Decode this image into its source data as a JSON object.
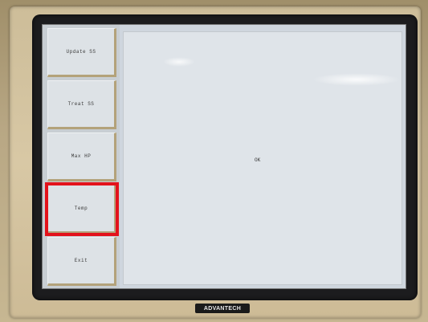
{
  "menu": {
    "items": [
      {
        "label": "Update SS"
      },
      {
        "label": "Treat SS"
      },
      {
        "label": "Max HP"
      },
      {
        "label": "Temp"
      },
      {
        "label": "Exit"
      }
    ],
    "selected_index": 3
  },
  "main": {
    "text": "OK"
  },
  "device": {
    "brand": "ADVANTECH"
  },
  "colors": {
    "selection_highlight": "#e3121b",
    "screen_background": "#dfe4e9",
    "button_face": "#dde2e6",
    "bezel": "#d8c8a5"
  }
}
